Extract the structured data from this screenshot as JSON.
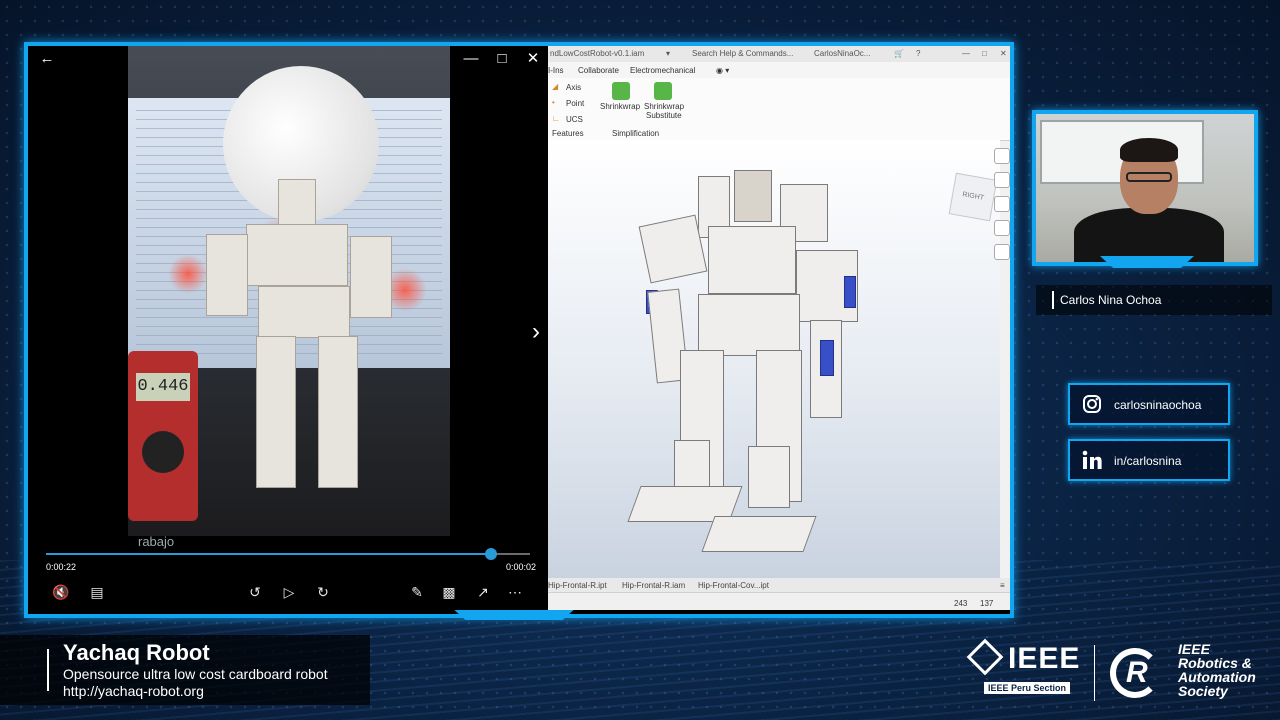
{
  "player": {
    "elapsed": "0:00:22",
    "remaining": "0:00:02",
    "progress": 0.92,
    "meter_reading": "0.446",
    "overlay_text": "rabajo",
    "icons": [
      "back-arrow-icon",
      "minimize-icon",
      "maximize-icon",
      "close-icon",
      "mute-icon",
      "captions-icon",
      "rewind-10-icon",
      "play-icon",
      "forward-30-icon",
      "pen-icon",
      "cast-icon",
      "fullscreen-icon",
      "more-icon",
      "next-arrow-icon"
    ]
  },
  "cad": {
    "title_file": "ndLowCostRobot-v0.1.iam",
    "search": "Search Help & Commands...",
    "user": "CarlosNinaOc...",
    "tabs": [
      "I-Ins",
      "Collaborate",
      "Electromechanical"
    ],
    "ribbon": {
      "axis": "Axis",
      "point": "Point",
      "ucs": "UCS",
      "features": "Features",
      "shrinkwrap": "Shrinkwrap",
      "shrinkwrap_substitute_1": "Shrinkwrap",
      "shrinkwrap_substitute_2": "Substitute",
      "simplification": "Simplification"
    },
    "doc_tabs": [
      "Hip-Frontal-R.ipt",
      "Hip-Frontal-R.iam",
      "Hip-Frontal-Cov...ipt"
    ],
    "status": {
      "a": "243",
      "b": "137"
    }
  },
  "presenter": {
    "name": "Carlos Nina Ochoa",
    "instagram": "carlosninaochoa",
    "linkedin": "in/carlosnina"
  },
  "lower_third": {
    "title": "Yachaq Robot",
    "subtitle": "Opensource ultra low cost cardboard robot",
    "url": "http://yachaq-robot.org"
  },
  "logos": {
    "ieee": "IEEE",
    "ieee_section": "IEEE Peru Section",
    "ras_line1": "IEEE",
    "ras_line2": "Robotics &",
    "ras_line3": "Automation",
    "ras_line4": "Society"
  },
  "colors": {
    "accent": "#12a6f0",
    "seek": "#2a9ad9",
    "background": "#0b2445"
  }
}
